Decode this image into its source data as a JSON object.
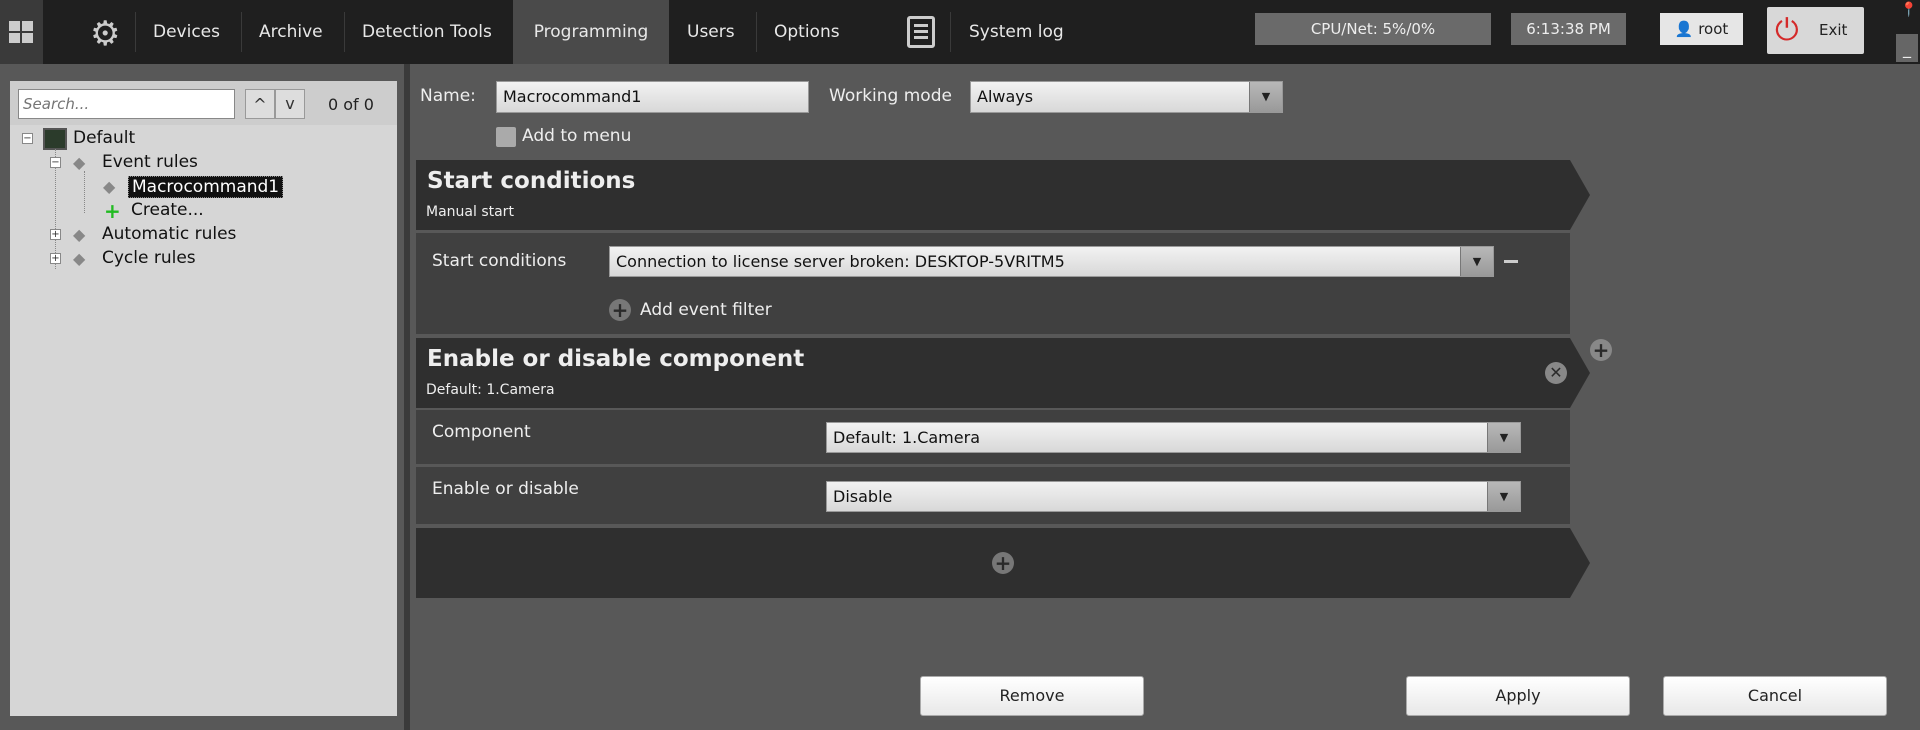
{
  "topbar": {
    "nav": [
      "Devices",
      "Archive",
      "Detection Tools",
      "Programming",
      "Users",
      "Options"
    ],
    "active": "Programming",
    "system_log": "System log",
    "cpu": "CPU/Net: 5%/0%",
    "time": "6:13:38 PM",
    "user": "root",
    "exit": "Exit"
  },
  "sidebar": {
    "search_placeholder": "Search...",
    "count": "0 of 0",
    "tree": {
      "root": "Default",
      "event_rules": "Event rules",
      "macro": "Macrocommand1",
      "create": "Create...",
      "automatic": "Automatic rules",
      "cycle": "Cycle rules"
    }
  },
  "form": {
    "name_label": "Name:",
    "name_value": "Macrocommand1",
    "mode_label": "Working mode",
    "mode_value": "Always",
    "add_to_menu": "Add to menu"
  },
  "start": {
    "title": "Start conditions",
    "subtitle": "Manual start",
    "row_label": "Start conditions",
    "row_value": "Connection to license server broken: DESKTOP-5VRITM5",
    "add_filter": "Add event filter"
  },
  "action": {
    "title": "Enable or disable component",
    "subtitle": "Default: 1.Camera",
    "component_label": "Component",
    "component_value": "Default: 1.Camera",
    "enable_label": "Enable or disable",
    "enable_value": "Disable"
  },
  "buttons": {
    "remove": "Remove",
    "apply": "Apply",
    "cancel": "Cancel"
  },
  "colors": {
    "exit_icon": "#d42a2a",
    "add_green": "#22bb22"
  }
}
